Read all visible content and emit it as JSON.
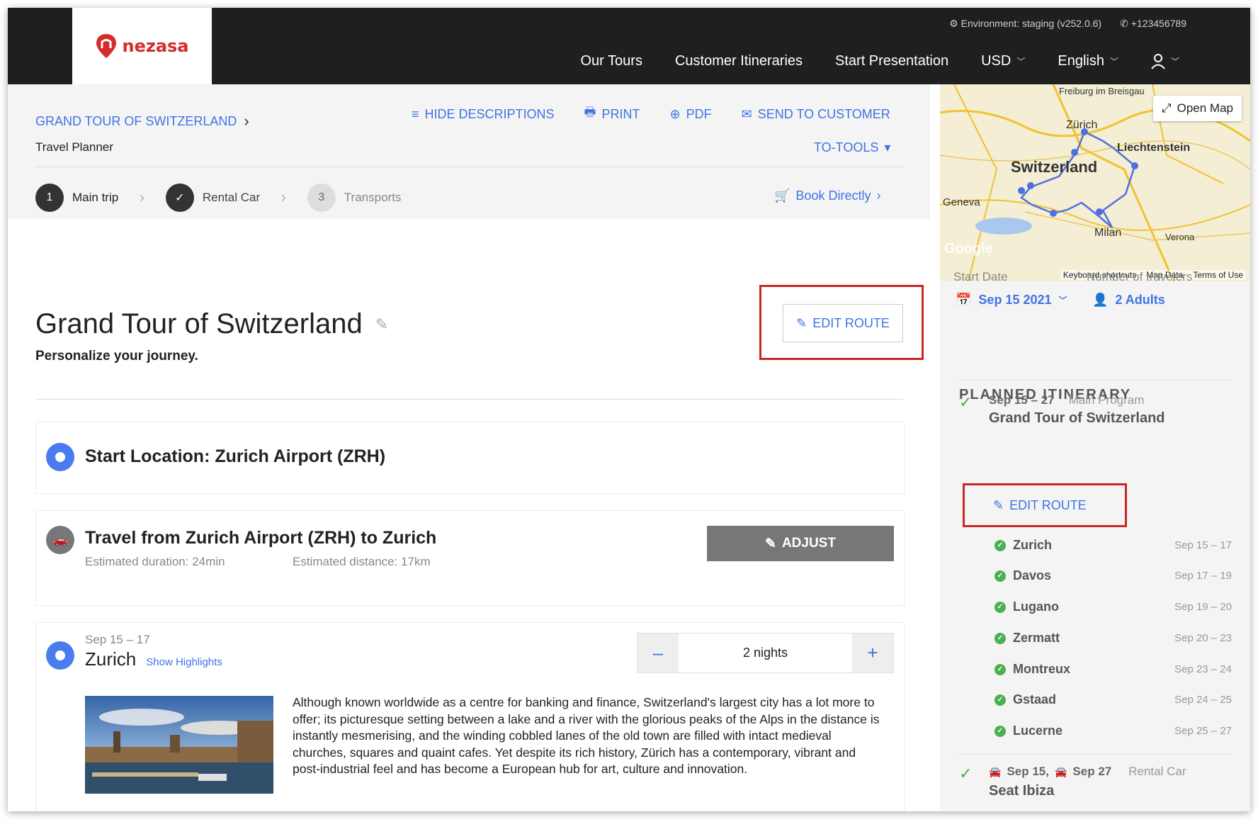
{
  "header": {
    "brand": "nezasa",
    "environment": "Environment: staging (v252.0.6)",
    "phone": "+123456789",
    "nav": [
      "Our Tours",
      "Customer Itineraries",
      "Start Presentation",
      "USD",
      "English"
    ]
  },
  "toolbar": {
    "breadcrumb": "GRAND TOUR OF SWITZERLAND",
    "page_label": "Travel Planner",
    "hide_descriptions": "HIDE DESCRIPTIONS",
    "print": "PRINT",
    "pdf": "PDF",
    "send": "SEND TO CUSTOMER",
    "to_tools": "TO-TOOLS",
    "book_directly": "Book Directly"
  },
  "steps": [
    {
      "num": "1",
      "label": "Main trip"
    },
    {
      "num": "",
      "label": "Rental Car"
    },
    {
      "num": "3",
      "label": "Transports"
    }
  ],
  "main": {
    "title": "Grand Tour of Switzerland",
    "subtitle": "Personalize your journey.",
    "edit_route": "EDIT ROUTE",
    "start_location": "Start Location: Zurich Airport (ZRH)",
    "transfer_title": "Travel from Zurich Airport (ZRH) to Zurich",
    "duration": "Estimated duration: 24min",
    "distance": "Estimated distance: 17km",
    "adjust": "ADJUST",
    "stop_dates": "Sep 15 – 17",
    "stop_name": "Zurich",
    "show_highlights": "Show Highlights",
    "nights_minus": "–",
    "nights": "2 nights",
    "nights_plus": "+",
    "description": "Although known worldwide as a centre for banking and finance, Switzerland's largest city has a lot more to offer; its picturesque setting between a lake and a river with the glorious peaks of the Alps in the distance is instantly mesmerising, and the winding cobbled lanes of the old town are filled with intact medieval churches, squares and quaint cafes. Yet despite its rich history, Zürich has a contemporary, vibrant and post-industrial feel and has become a European hub for art, culture and innovation."
  },
  "sidebar": {
    "map": {
      "open_map": "Open Map",
      "labels": [
        "Freiburg im Breisgau",
        "Zürich",
        "Liechtenstein",
        "Switzerland",
        "Geneva",
        "Milan",
        "Verona",
        "Google"
      ],
      "footer": [
        "Keyboard shortcuts",
        "Map Data",
        "Terms of Use"
      ]
    },
    "start_date_label": "Start Date",
    "start_date": "Sep 15 2021",
    "travelers_label": "Number of travelers",
    "travelers": "2 Adults",
    "planned_title": "PLANNED ITINERARY",
    "program": {
      "dates": "Sep 15 – 27",
      "type": "Main Program",
      "name": "Grand Tour of Switzerland"
    },
    "edit_route": "EDIT ROUTE",
    "stops": [
      {
        "name": "Zurich",
        "dates": "Sep 15 – 17"
      },
      {
        "name": "Davos",
        "dates": "Sep 17 – 19"
      },
      {
        "name": "Lugano",
        "dates": "Sep 19 – 20"
      },
      {
        "name": "Zermatt",
        "dates": "Sep 20 – 23"
      },
      {
        "name": "Montreux",
        "dates": "Sep 23 – 24"
      },
      {
        "name": "Gstaad",
        "dates": "Sep 24 – 25"
      },
      {
        "name": "Lucerne",
        "dates": "Sep 25 – 27"
      }
    ],
    "rental": {
      "start": "Sep 15,",
      "end": "Sep 27",
      "type": "Rental Car",
      "name": "Seat Ibiza"
    }
  },
  "colors": {
    "accent": "#3e74e6",
    "topbar": "#1f1f1f",
    "highlight_box": "#c62828",
    "ok": "#4caf50"
  }
}
